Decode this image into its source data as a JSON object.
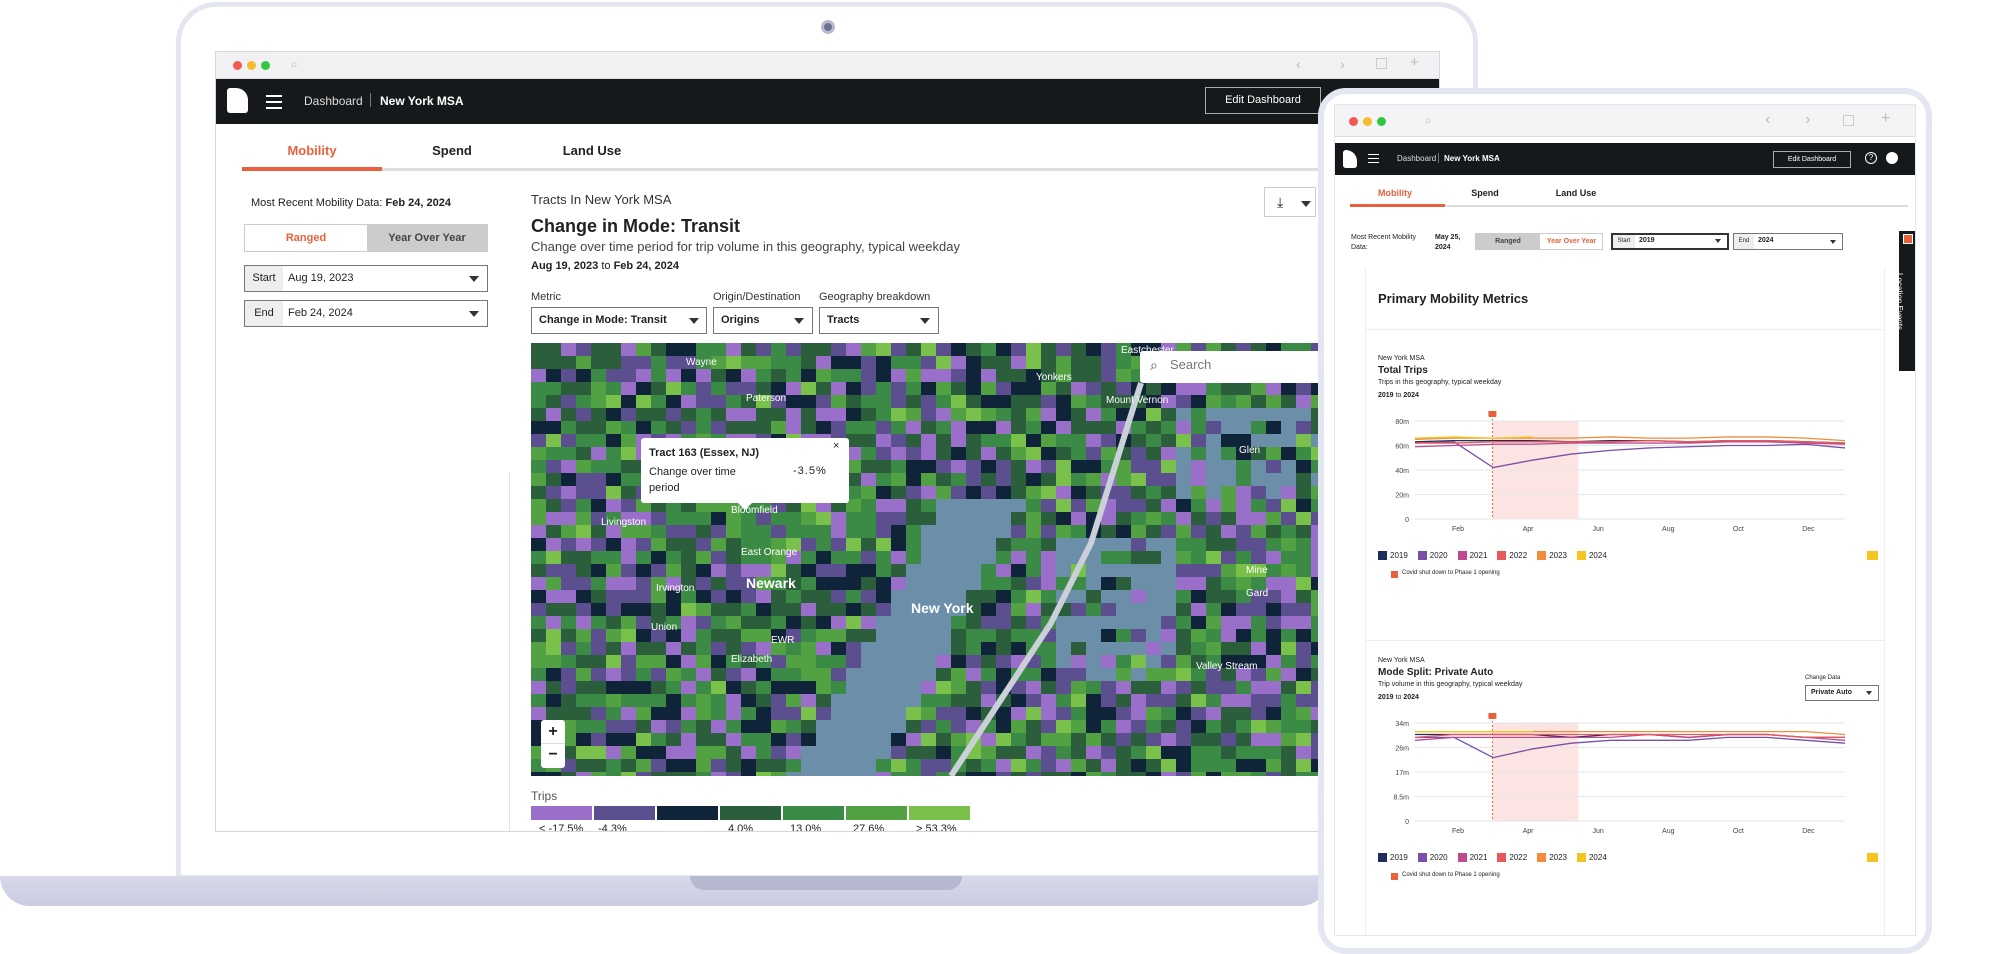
{
  "laptop": {
    "nav": {
      "dashboard": "Dashboard",
      "region": "New York MSA",
      "edit": "Edit Dashboard"
    },
    "tabs": [
      {
        "label": "Mobility"
      },
      {
        "label": "Spend"
      },
      {
        "label": "Land Use"
      }
    ],
    "recent_label": "Most Recent Mobility Data:",
    "recent_date": "Feb 24, 2024",
    "toggle": {
      "ranged": "Ranged",
      "yoy": "Year Over Year"
    },
    "start": {
      "label": "Start",
      "value": "Aug 19, 2023"
    },
    "end": {
      "label": "End",
      "value": "Feb 24, 2024"
    },
    "panel": {
      "kicker": "Tracts In New York MSA",
      "title": "Change in Mode: Transit",
      "subtitle": "Change over time period for trip volume in this geography, typical weekday",
      "from": "Aug 19, 2023",
      "to_word": "to",
      "to": "Feb 24, 2024"
    },
    "filters": {
      "metric_label": "Metric",
      "metric": "Change in Mode: Transit",
      "od_label": "Origin/Destination",
      "od": "Origins",
      "geo_label": "Geography breakdown",
      "geo": "Tracts"
    },
    "map": {
      "search_placeholder": "Search",
      "places": [
        "Wayne",
        "Paterson",
        "Yonkers",
        "Mount Vernon",
        "Eastchester",
        "Bloomfield",
        "Livingston",
        "East Orange",
        "Irvington",
        "Newark",
        "Union",
        "EWR",
        "Elizabeth",
        "New York",
        "Valley Stream",
        "Glen",
        "Mine",
        "Gard"
      ],
      "tooltip": {
        "title": "Tract 163 (Essex, NJ)",
        "label": "Change over time period",
        "value": "-3.5%",
        "close": "×"
      },
      "zoom_in": "+",
      "zoom_out": "−"
    },
    "legend": {
      "title": "Trips",
      "labels": [
        "< -17.5%",
        "-4.3%",
        "4.0%",
        "13.0%",
        "27.6%",
        "> 53.3%"
      ],
      "colors": [
        "#9a6fca",
        "#5b4f8f",
        "#0f2439",
        "#2b5f3c",
        "#3b8a45",
        "#52a244",
        "#79c14a"
      ]
    }
  },
  "tablet": {
    "nav": {
      "dashboard": "Dashboard",
      "region": "New York MSA",
      "edit": "Edit Dashboard"
    },
    "tabs": [
      {
        "label": "Mobility"
      },
      {
        "label": "Spend"
      },
      {
        "label": "Land Use"
      }
    ],
    "recent_label": "Most Recent Mobility Data:",
    "recent_date": "May 25, 2024",
    "toggle": {
      "ranged": "Ranged",
      "yoy": "Year Over Year"
    },
    "start": {
      "label": "Start",
      "value": "2019"
    },
    "end": {
      "label": "End",
      "value": "2024"
    },
    "side_tab": "Location Events",
    "section_title": "Primary Mobility Metrics",
    "change_data_label": "Change Data",
    "change_data_value": "Private Auto",
    "covid_note": "Covid shut down to Phase 1 opening"
  },
  "chart_data": [
    {
      "type": "line",
      "kicker": "New York MSA",
      "title": "Total Trips",
      "subtitle": "Trips in this geography, typical weekday",
      "range_from": "2019",
      "range_to": "2024",
      "yticks": [
        "80m",
        "60m",
        "40m",
        "20m",
        "0"
      ],
      "ylim": [
        0,
        80
      ],
      "xticks": [
        "Feb",
        "Apr",
        "Jun",
        "Aug",
        "Oct",
        "Dec"
      ],
      "x": [
        1,
        2,
        3,
        4,
        5,
        6,
        7,
        8,
        9,
        10,
        11,
        12
      ],
      "series": [
        {
          "name": "2019",
          "color": "#1f2d5c",
          "values": [
            63,
            64,
            64,
            64,
            63,
            64,
            64,
            63,
            64,
            64,
            63,
            62
          ]
        },
        {
          "name": "2020",
          "color": "#7a4fa8",
          "values": [
            62,
            63,
            42,
            48,
            53,
            56,
            58,
            59,
            60,
            60,
            61,
            58
          ]
        },
        {
          "name": "2021",
          "color": "#c04a8f",
          "values": [
            59,
            60,
            61,
            61,
            62,
            62,
            62,
            62,
            63,
            63,
            62,
            61
          ]
        },
        {
          "name": "2022",
          "color": "#e8585a",
          "values": [
            62,
            62,
            63,
            63,
            63,
            63,
            64,
            63,
            64,
            64,
            63,
            62
          ]
        },
        {
          "name": "2023",
          "color": "#f28c3b",
          "values": [
            65,
            66,
            66,
            66,
            66,
            67,
            66,
            66,
            67,
            67,
            66,
            64
          ]
        },
        {
          "name": "2024",
          "color": "#f5c51f",
          "values": [
            66,
            67,
            66,
            67,
            null,
            null,
            null,
            null,
            null,
            null,
            null,
            null
          ]
        }
      ]
    },
    {
      "type": "line",
      "kicker": "New York MSA",
      "title": "Mode Split: Private Auto",
      "subtitle": "Trip volume in this geography, typical weekday",
      "range_from": "2019",
      "range_to": "2024",
      "yticks": [
        "34m",
        "26m",
        "17m",
        "8.5m",
        "0"
      ],
      "ylim": [
        0,
        34
      ],
      "xticks": [
        "Feb",
        "Apr",
        "Jun",
        "Aug",
        "Oct",
        "Dec"
      ],
      "x": [
        1,
        2,
        3,
        4,
        5,
        6,
        7,
        8,
        9,
        10,
        11,
        12
      ],
      "series": [
        {
          "name": "2019",
          "color": "#1f2d5c",
          "values": [
            30,
            30,
            30,
            30,
            29,
            30,
            30,
            29,
            30,
            30,
            29,
            29
          ]
        },
        {
          "name": "2020",
          "color": "#7a4fa8",
          "values": [
            29,
            29,
            22,
            25,
            27,
            28,
            28,
            28,
            29,
            29,
            28,
            27
          ]
        },
        {
          "name": "2021",
          "color": "#c04a8f",
          "values": [
            28,
            29,
            29,
            29,
            29,
            29,
            30,
            29,
            30,
            30,
            29,
            28
          ]
        },
        {
          "name": "2022",
          "color": "#e8585a",
          "values": [
            29,
            30,
            30,
            30,
            30,
            30,
            30,
            30,
            30,
            30,
            29,
            29
          ]
        },
        {
          "name": "2023",
          "color": "#f28c3b",
          "values": [
            31,
            31,
            31,
            31,
            31,
            31,
            31,
            31,
            31,
            31,
            31,
            30
          ]
        },
        {
          "name": "2024",
          "color": "#f5c51f",
          "values": [
            31,
            31,
            31,
            31,
            null,
            null,
            null,
            null,
            null,
            null,
            null,
            null
          ]
        }
      ]
    }
  ]
}
